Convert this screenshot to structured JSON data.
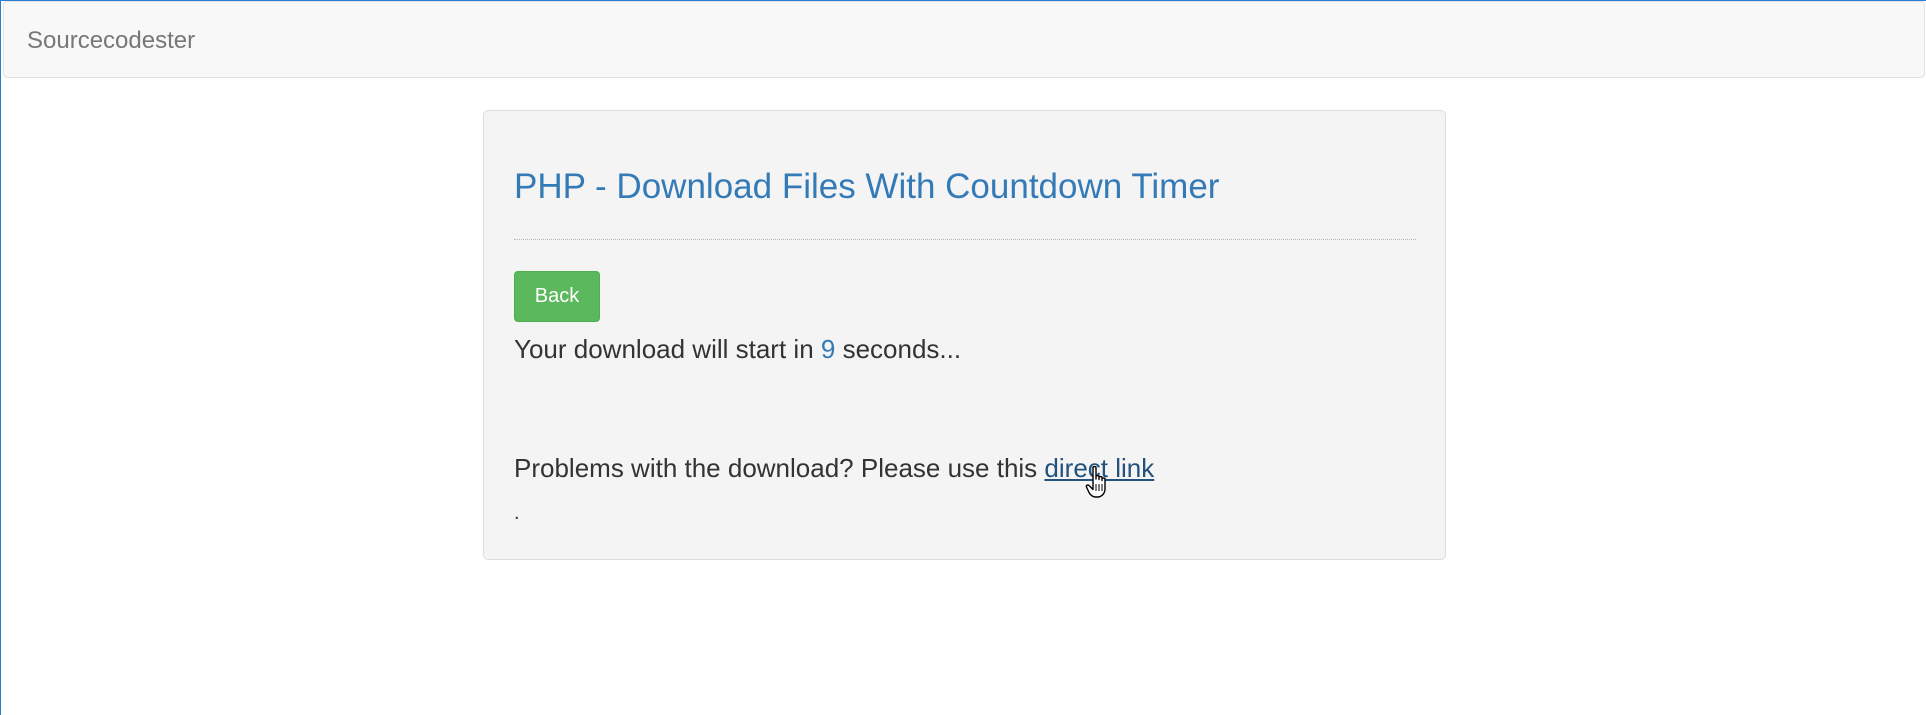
{
  "navbar": {
    "brand": "Sourcecodester"
  },
  "panel": {
    "title": "PHP - Download Files With Countdown Timer",
    "back_label": "Back",
    "countdown": {
      "prefix": "Your download will start in ",
      "seconds": "9",
      "suffix": " seconds..."
    },
    "problem": {
      "text": "Problems with the download? Please use this ",
      "link_label": "direct link"
    },
    "trailing_period": "."
  },
  "colors": {
    "accent": "#337ab7",
    "link": "#23527c",
    "success": "#5cb85c",
    "panel_bg": "#f4f4f4",
    "navbar_bg": "#f8f8f8"
  },
  "icons": {
    "cursor": "hand-pointer-icon"
  }
}
